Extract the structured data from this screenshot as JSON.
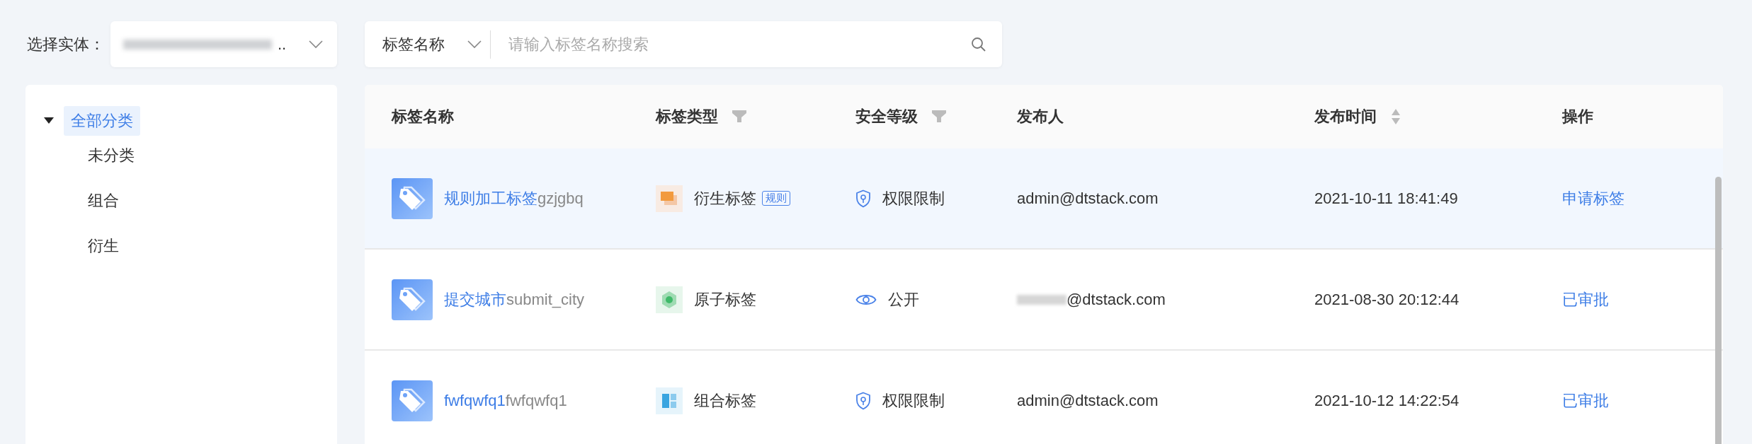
{
  "entity_select": {
    "label": "选择实体：",
    "value": ".."
  },
  "search": {
    "field_select": "标签名称",
    "placeholder": "请输入标签名称搜索"
  },
  "tree": [
    {
      "label": "全部分类",
      "selected": true,
      "expanded": true,
      "children": [
        {
          "label": "未分类",
          "selected": false
        },
        {
          "label": "组合",
          "selected": false
        },
        {
          "label": "衍生",
          "selected": false
        }
      ]
    }
  ],
  "table": {
    "columns": [
      {
        "label": "标签名称",
        "kind": "plain"
      },
      {
        "label": "标签类型",
        "kind": "filter"
      },
      {
        "label": "安全等级",
        "kind": "filter"
      },
      {
        "label": "发布人",
        "kind": "plain"
      },
      {
        "label": "发布时间",
        "kind": "sort"
      },
      {
        "label": "操作",
        "kind": "plain"
      }
    ],
    "rows": [
      {
        "selected": true,
        "name": "规则加工标签",
        "code": "gzjgbq",
        "type": {
          "kind": "derived",
          "label": "衍生标签",
          "badge": "规则"
        },
        "security": {
          "kind": "restricted",
          "label": "权限限制"
        },
        "publisher": "admin@dtstack.com",
        "publisher_redacted": false,
        "time": "2021-10-11 18:41:49",
        "action": "申请标签"
      },
      {
        "selected": false,
        "name": "提交城市",
        "code": "submit_city",
        "type": {
          "kind": "atomic",
          "label": "原子标签"
        },
        "security": {
          "kind": "public",
          "label": "公开"
        },
        "publisher": "@dtstack.com",
        "publisher_redacted": true,
        "time": "2021-08-30 20:12:44",
        "action": "已审批"
      },
      {
        "selected": false,
        "name": "fwfqwfq1",
        "code": "fwfqwfq1",
        "type": {
          "kind": "combined",
          "label": "组合标签"
        },
        "security": {
          "kind": "restricted",
          "label": "权限限制"
        },
        "publisher": "admin@dtstack.com",
        "publisher_redacted": false,
        "time": "2021-10-12 14:22:54",
        "action": "已审批"
      }
    ]
  }
}
